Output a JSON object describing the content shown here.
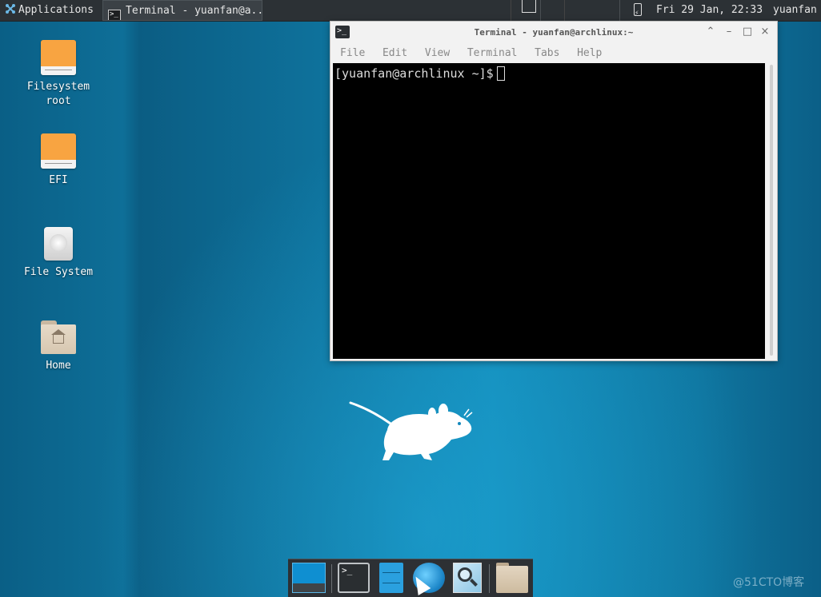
{
  "panel": {
    "applications_label": "Applications",
    "task_label": "Terminal - yuanfan@a...",
    "clock": "Fri 29 Jan, 22:33",
    "user": "yuanfan"
  },
  "desktop_icons": [
    {
      "label_line1": "Filesystem",
      "label_line2": "root",
      "icon": "drive-icon"
    },
    {
      "label_line1": "EFI",
      "label_line2": "",
      "icon": "drive-icon"
    },
    {
      "label_line1": "File System",
      "label_line2": "",
      "icon": "harddisk-icon"
    },
    {
      "label_line1": "Home",
      "label_line2": "",
      "icon": "home-folder-icon"
    }
  ],
  "terminal": {
    "title": "Terminal - yuanfan@archlinux:~",
    "menu": [
      "File",
      "Edit",
      "View",
      "Terminal",
      "Tabs",
      "Help"
    ],
    "prompt": "[yuanfan@archlinux ~]$"
  },
  "dock": {
    "items": [
      "show-desktop-icon",
      "terminal-icon",
      "file-cabinet-icon",
      "web-browser-icon",
      "app-finder-icon",
      "folder-icon"
    ]
  },
  "watermark": "@51CTO博客",
  "colors": {
    "panel_bg": "#2c3135",
    "desktop_blue": "#0f77a2",
    "terminal_bg": "#000000",
    "drive_orange": "#f8a441"
  }
}
